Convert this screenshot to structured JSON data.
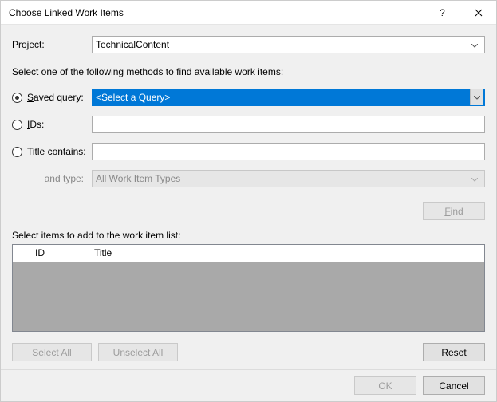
{
  "titlebar": {
    "title": "Choose Linked Work Items"
  },
  "project": {
    "label": "Project:",
    "value": "TechnicalContent"
  },
  "instruction": "Select one of the following methods to find available work items:",
  "methods": {
    "saved_query": {
      "label": "Saved query:",
      "value": "<Select a Query>"
    },
    "ids": {
      "label": "IDs:"
    },
    "title_contains": {
      "label": "Title contains:"
    },
    "and_type": {
      "label": "and type:",
      "value": "All Work Item Types"
    }
  },
  "find_label": "Find",
  "grid": {
    "label": "Select items to add to the work item list:",
    "cols": {
      "id": "ID",
      "title": "Title"
    }
  },
  "buttons": {
    "select_all": "Select All",
    "unselect_all": "Unselect All",
    "reset": "Reset",
    "ok": "OK",
    "cancel": "Cancel"
  }
}
